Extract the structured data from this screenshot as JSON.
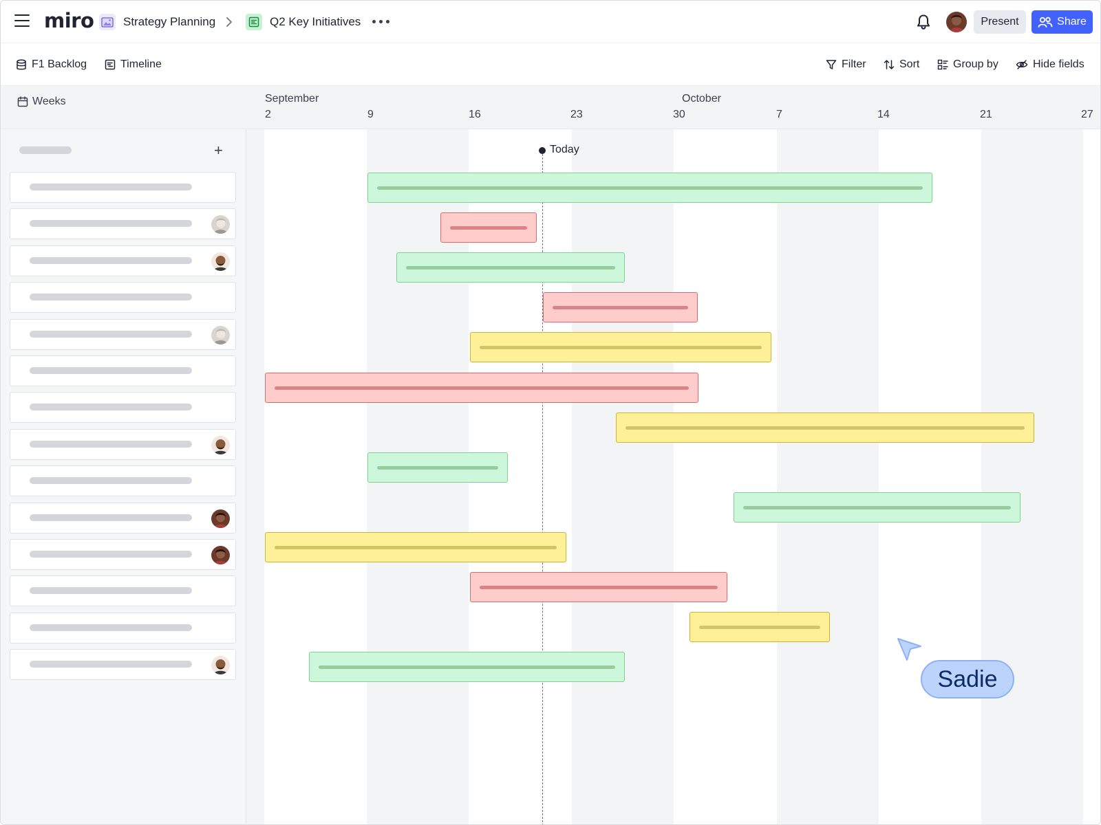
{
  "app": {
    "logo": "miro"
  },
  "breadcrumb": [
    {
      "label": "Strategy Planning"
    },
    {
      "label": "Q2 Key Initiatives"
    }
  ],
  "header": {
    "present_label": "Present",
    "share_label": "Share"
  },
  "toolbar": {
    "left": [
      {
        "label": "F1 Backlog"
      },
      {
        "label": "Timeline"
      }
    ],
    "right": [
      {
        "label": "Filter"
      },
      {
        "label": "Sort"
      },
      {
        "label": "Group by"
      },
      {
        "label": "Hide fields"
      }
    ]
  },
  "timeline": {
    "scale_label": "Weeks",
    "months": [
      {
        "label": "September"
      },
      {
        "label": "October"
      }
    ],
    "days": [
      "2",
      "9",
      "16",
      "23",
      "30",
      "7",
      "14",
      "21",
      "27"
    ],
    "today_label": "Today"
  },
  "rows": [
    {
      "avatar": null
    },
    {
      "avatar": "gray"
    },
    {
      "avatar": "bald"
    },
    {
      "avatar": null
    },
    {
      "avatar": "gray"
    },
    {
      "avatar": null
    },
    {
      "avatar": null
    },
    {
      "avatar": "bald"
    },
    {
      "avatar": null
    },
    {
      "avatar": "woman"
    },
    {
      "avatar": "woman"
    },
    {
      "avatar": null
    },
    {
      "avatar": null
    },
    {
      "avatar": "bald"
    }
  ],
  "bars": [
    {
      "color": "green",
      "start": "Sep 9",
      "end": "Oct 17"
    },
    {
      "color": "red",
      "start": "Sep 14",
      "end": "Sep 20"
    },
    {
      "color": "green",
      "start": "Sep 11",
      "end": "Sep 26"
    },
    {
      "color": "red",
      "start": "Sep 21",
      "end": "Oct 1"
    },
    {
      "color": "yellow",
      "start": "Sep 16",
      "end": "Oct 6"
    },
    {
      "color": "red",
      "start": "Sep 2",
      "end": "Oct 1"
    },
    {
      "color": "yellow",
      "start": "Sep 26",
      "end": "Oct 24"
    },
    {
      "color": "green",
      "start": "Sep 9",
      "end": "Sep 18"
    },
    {
      "color": "green",
      "start": "Oct 4",
      "end": "Oct 23"
    },
    {
      "color": "yellow",
      "start": "Sep 2",
      "end": "Sep 22"
    },
    {
      "color": "red",
      "start": "Sep 16",
      "end": "Oct 3"
    },
    {
      "color": "yellow",
      "start": "Oct 1",
      "end": "Oct 10"
    },
    {
      "color": "green",
      "start": "Sep 5",
      "end": "Sep 26"
    }
  ],
  "collaborator": {
    "name": "Sadie",
    "color": "#bcd4fb"
  },
  "colors": {
    "accent": "#4262ff",
    "green": "#ccf7da",
    "red": "#ffcccc",
    "yellow": "#fdf097"
  }
}
